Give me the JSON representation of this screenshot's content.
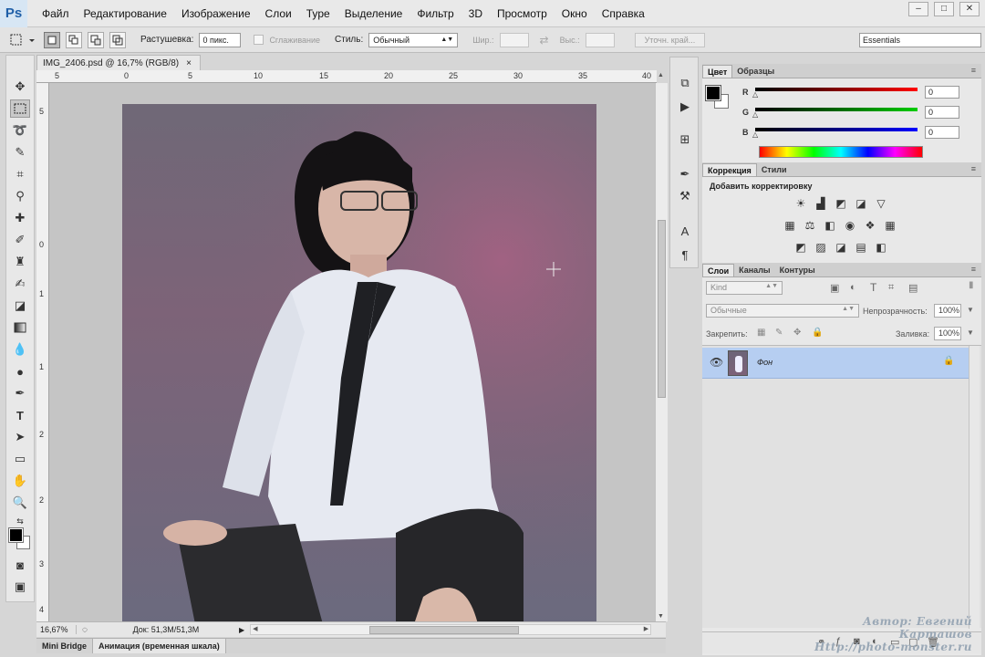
{
  "app": {
    "logo": "Ps",
    "menu": [
      "Файл",
      "Редактирование",
      "Изображение",
      "Слои",
      "Type",
      "Выделение",
      "Фильтр",
      "3D",
      "Просмотр",
      "Окно",
      "Справка"
    ],
    "window_controls": [
      "–",
      "□",
      "✕"
    ]
  },
  "options_bar": {
    "feather_label": "Растушевка:",
    "feather_value": "0 пикс.",
    "antialias_label": "Сглаживание",
    "style_label": "Стиль:",
    "style_value": "Обычный",
    "width_label": "Шир.:",
    "height_label": "Выс.:",
    "refine_edge": "Уточн. край...",
    "workspace": "Essentials"
  },
  "document": {
    "tab_title": "IMG_2406.psd @ 16,7% (RGB/8)",
    "tab_close": "×",
    "ruler_h": [
      "5",
      "0",
      "5",
      "10",
      "15",
      "20",
      "25",
      "30",
      "35",
      "40"
    ],
    "ruler_v": [
      "5",
      "0",
      "1",
      "1",
      "2",
      "2",
      "3",
      "4"
    ],
    "zoom": "16,67%",
    "doc_info": "Док: 51,3M/51,3M"
  },
  "bottom_tabs": [
    "Mini Bridge",
    "Анимация (временная шкала)"
  ],
  "color_panel": {
    "tabs": [
      "Цвет",
      "Образцы"
    ],
    "r_label": "R",
    "g_label": "G",
    "b_label": "B",
    "r_value": "0",
    "g_value": "0",
    "b_value": "0"
  },
  "adjustments_panel": {
    "tabs": [
      "Коррекция",
      "Стили"
    ],
    "heading": "Добавить корректировку"
  },
  "layers_panel": {
    "tabs": [
      "Слои",
      "Каналы",
      "Контуры"
    ],
    "kind_filter": "Kind",
    "blend_mode": "Обычные",
    "opacity_label": "Непрозрачность:",
    "opacity_value": "100%",
    "lock_label": "Закрепить:",
    "fill_label": "Заливка:",
    "fill_value": "100%",
    "layers": [
      {
        "name": "Фон",
        "visible": true,
        "locked": true
      }
    ]
  },
  "watermark": {
    "line1": "Автор: Евгений Карташов",
    "line2": "Http://photo-monster.ru"
  }
}
